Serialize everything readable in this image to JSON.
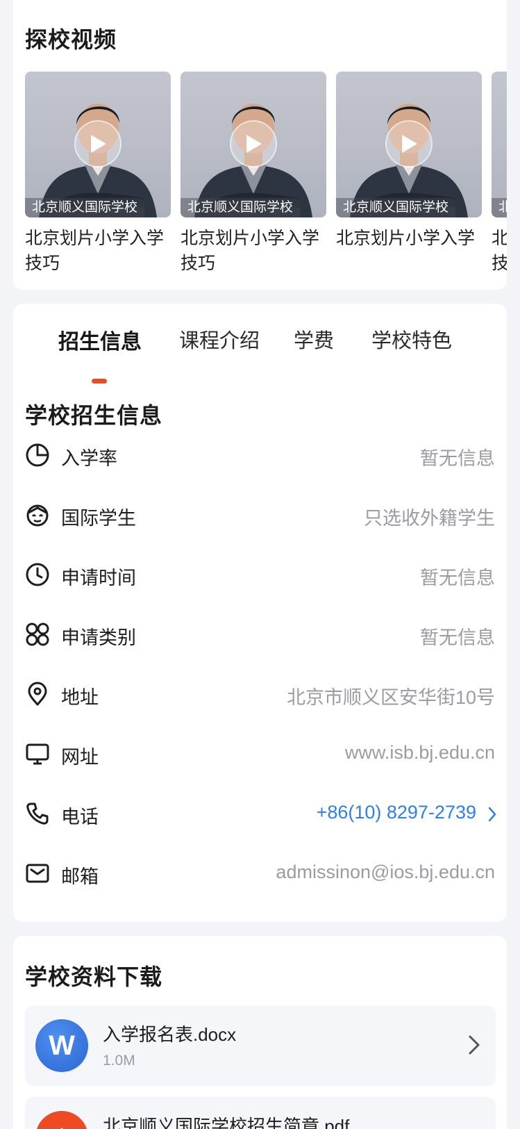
{
  "videos_section": {
    "title": "探校视频",
    "items": [
      {
        "caption": "北京顺义国际学校",
        "title": "北京划片小学入学技巧"
      },
      {
        "caption": "北京顺义国际学校",
        "title": "北京划片小学入学技巧"
      },
      {
        "caption": "北京顺义国际学校",
        "title": "北京划片小学入学"
      },
      {
        "caption": "北京顺义国际学校",
        "title": "北京划片小学入学技巧"
      }
    ]
  },
  "tabs": [
    {
      "label": "招生信息",
      "active": true
    },
    {
      "label": "课程介绍",
      "active": false
    },
    {
      "label": "学费",
      "active": false
    },
    {
      "label": "学校特色",
      "active": false
    }
  ],
  "accent_color": "#f04a1e",
  "link_color": "#2f7fe8",
  "admissions": {
    "title": "学校招生信息",
    "rows": [
      {
        "icon": "pie-chart-icon",
        "label": "入学率",
        "value": "暂无信息"
      },
      {
        "icon": "international-student-icon",
        "label": "国际学生",
        "value": "只选收外籍学生"
      },
      {
        "icon": "clock-icon",
        "label": "申请时间",
        "value": "暂无信息"
      },
      {
        "icon": "category-icon",
        "label": "申请类别",
        "value": "暂无信息"
      },
      {
        "icon": "location-pin-icon",
        "label": "地址",
        "value": "北京市顺义区安华街10号"
      },
      {
        "icon": "monitor-icon",
        "label": "网址",
        "value": "www.isb.bj.edu.cn"
      },
      {
        "icon": "phone-icon",
        "label": "电话",
        "value": "+86(10) 8297-2739"
      },
      {
        "icon": "mail-icon",
        "label": "邮箱",
        "value": "admissinon@ios.bj.edu.cn"
      }
    ]
  },
  "downloads": {
    "title": "学校资料下载",
    "files": [
      {
        "icon": "word-doc-icon",
        "icon_letter": "W",
        "name": "入学报名表.docx",
        "size": "1.0M"
      },
      {
        "icon": "pdf-icon",
        "icon_letter": "",
        "name": "北京顺义国际学校招生简章.pdf",
        "size": ""
      }
    ]
  }
}
